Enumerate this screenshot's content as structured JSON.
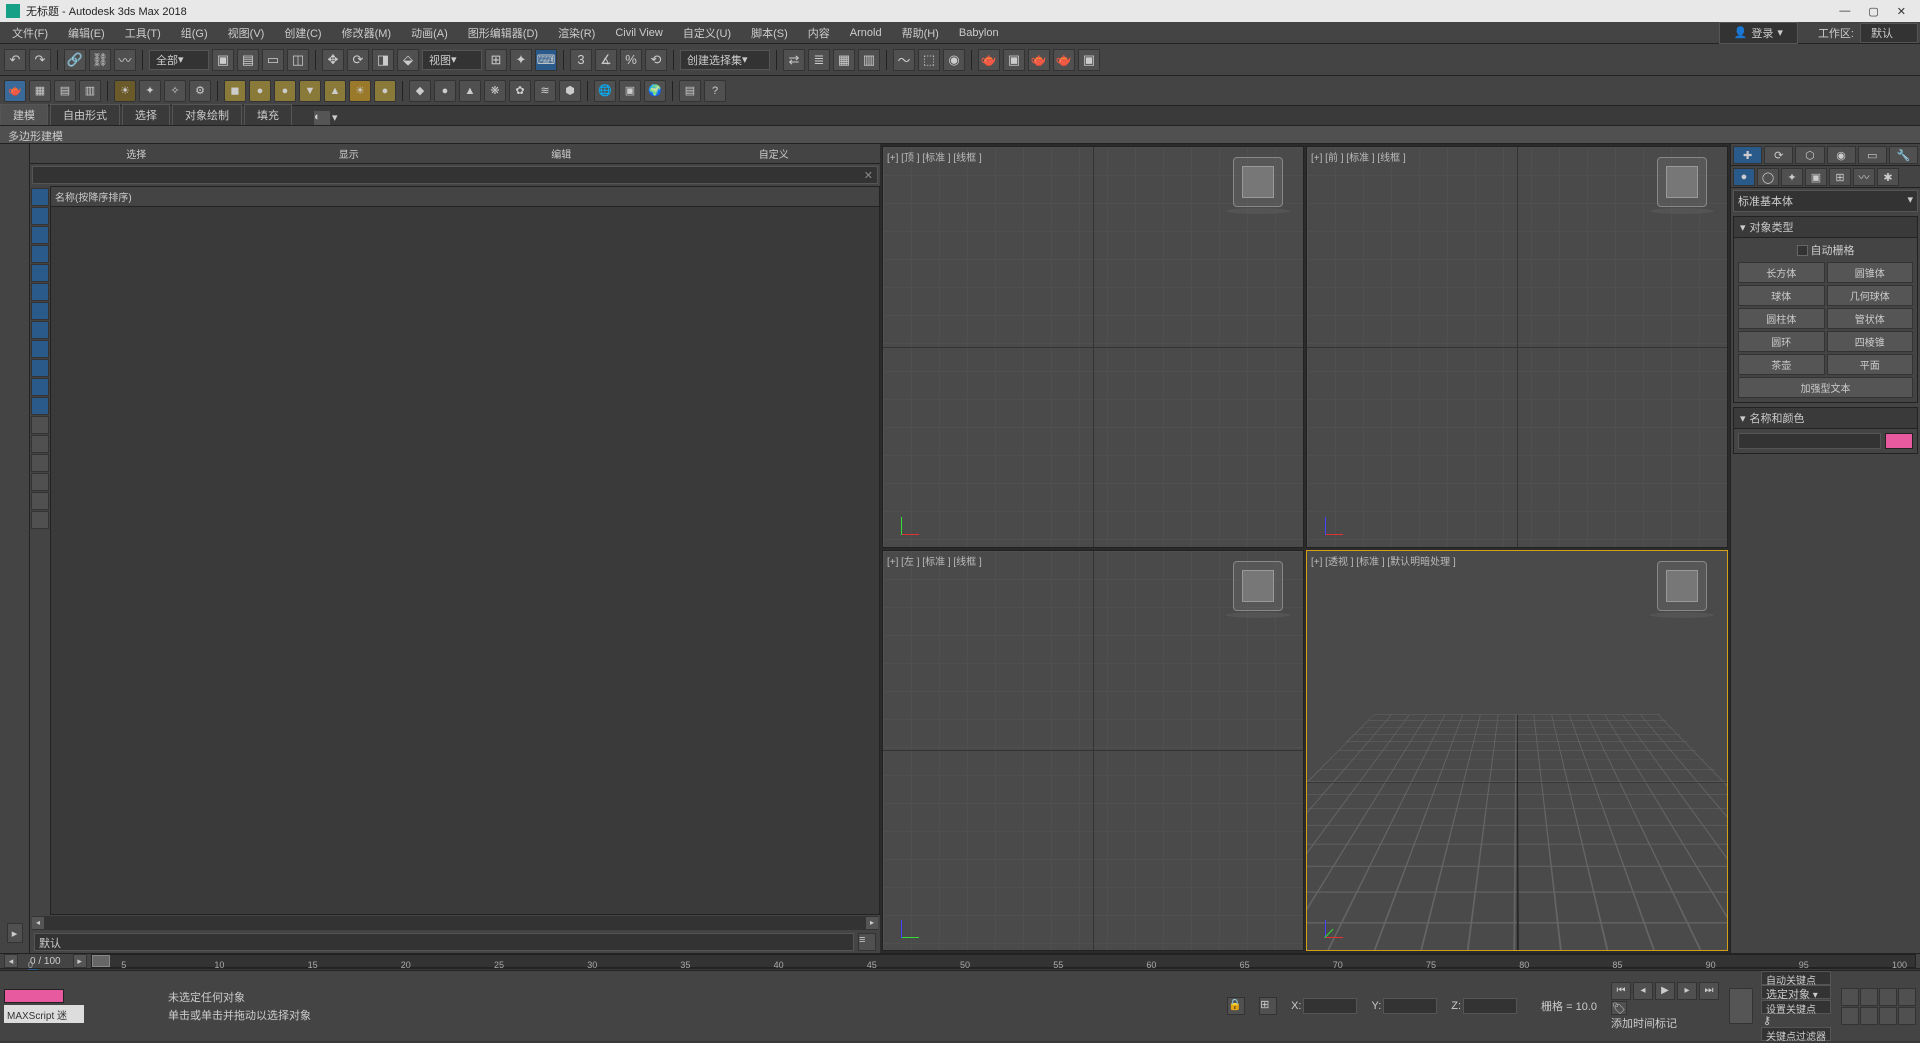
{
  "title": "无标题 - Autodesk 3ds Max 2018",
  "window_controls": {
    "min": "—",
    "max": "▢",
    "close": "✕"
  },
  "menubar": [
    "文件(F)",
    "编辑(E)",
    "工具(T)",
    "组(G)",
    "视图(V)",
    "创建(C)",
    "修改器(M)",
    "动画(A)",
    "图形编辑器(D)",
    "渲染(R)",
    "Civil View",
    "自定义(U)",
    "脚本(S)",
    "内容",
    "Arnold",
    "帮助(H)",
    "Babylon"
  ],
  "login_label": "登录",
  "workspace_label": "工作区:",
  "workspace_value": "默认",
  "toolbar1_combo_all": "全部",
  "toolbar1_combo_view": "视图",
  "toolbar1_combo_selset": "创建选择集",
  "ribbon_tabs": [
    "建模",
    "自由形式",
    "选择",
    "对象绘制",
    "填充"
  ],
  "ribbon_sub": "多边形建模",
  "scene_explorer": {
    "tabs": [
      "选择",
      "显示",
      "编辑",
      "自定义"
    ],
    "header": "名称(按降序排序)",
    "layer_default": "默认"
  },
  "viewports": {
    "top": "[+] [顶 ] [标准 ] [线框 ]",
    "front": "[+] [前 ] [标准 ] [线框 ]",
    "left": "[+] [左 ] [标准 ] [线框 ]",
    "persp": "[+] [透视 ] [标准 ] [默认明暗处理 ]"
  },
  "command_panel": {
    "dropdown": "标准基本体",
    "rollout_objtype": "对象类型",
    "auto_grid": "自动栅格",
    "objects": [
      "长方体",
      "圆锥体",
      "球体",
      "几何球体",
      "圆柱体",
      "管状体",
      "圆环",
      "四棱锥",
      "茶壶",
      "平面",
      "加强型文本"
    ],
    "rollout_name": "名称和颜色"
  },
  "timeline": {
    "frame_display": "0  /  100",
    "ticks": [
      "0",
      "5",
      "10",
      "15",
      "20",
      "25",
      "30",
      "35",
      "40",
      "45",
      "50",
      "55",
      "60",
      "65",
      "70",
      "75",
      "80",
      "85",
      "90",
      "95",
      "100"
    ]
  },
  "status": {
    "maxscript": "MAXScript  迷",
    "no_selection": "未选定任何对象",
    "hint": "单击或单击并拖动以选择对象",
    "x": "X:",
    "y": "Y:",
    "z": "Z:",
    "grid": "栅格 = 10.0",
    "add_time_tag": "添加时间标记",
    "auto_key": "自动关键点",
    "set_key": "设置关键点",
    "selected_obj": "选定对象",
    "key_filter": "关键点过滤器"
  }
}
